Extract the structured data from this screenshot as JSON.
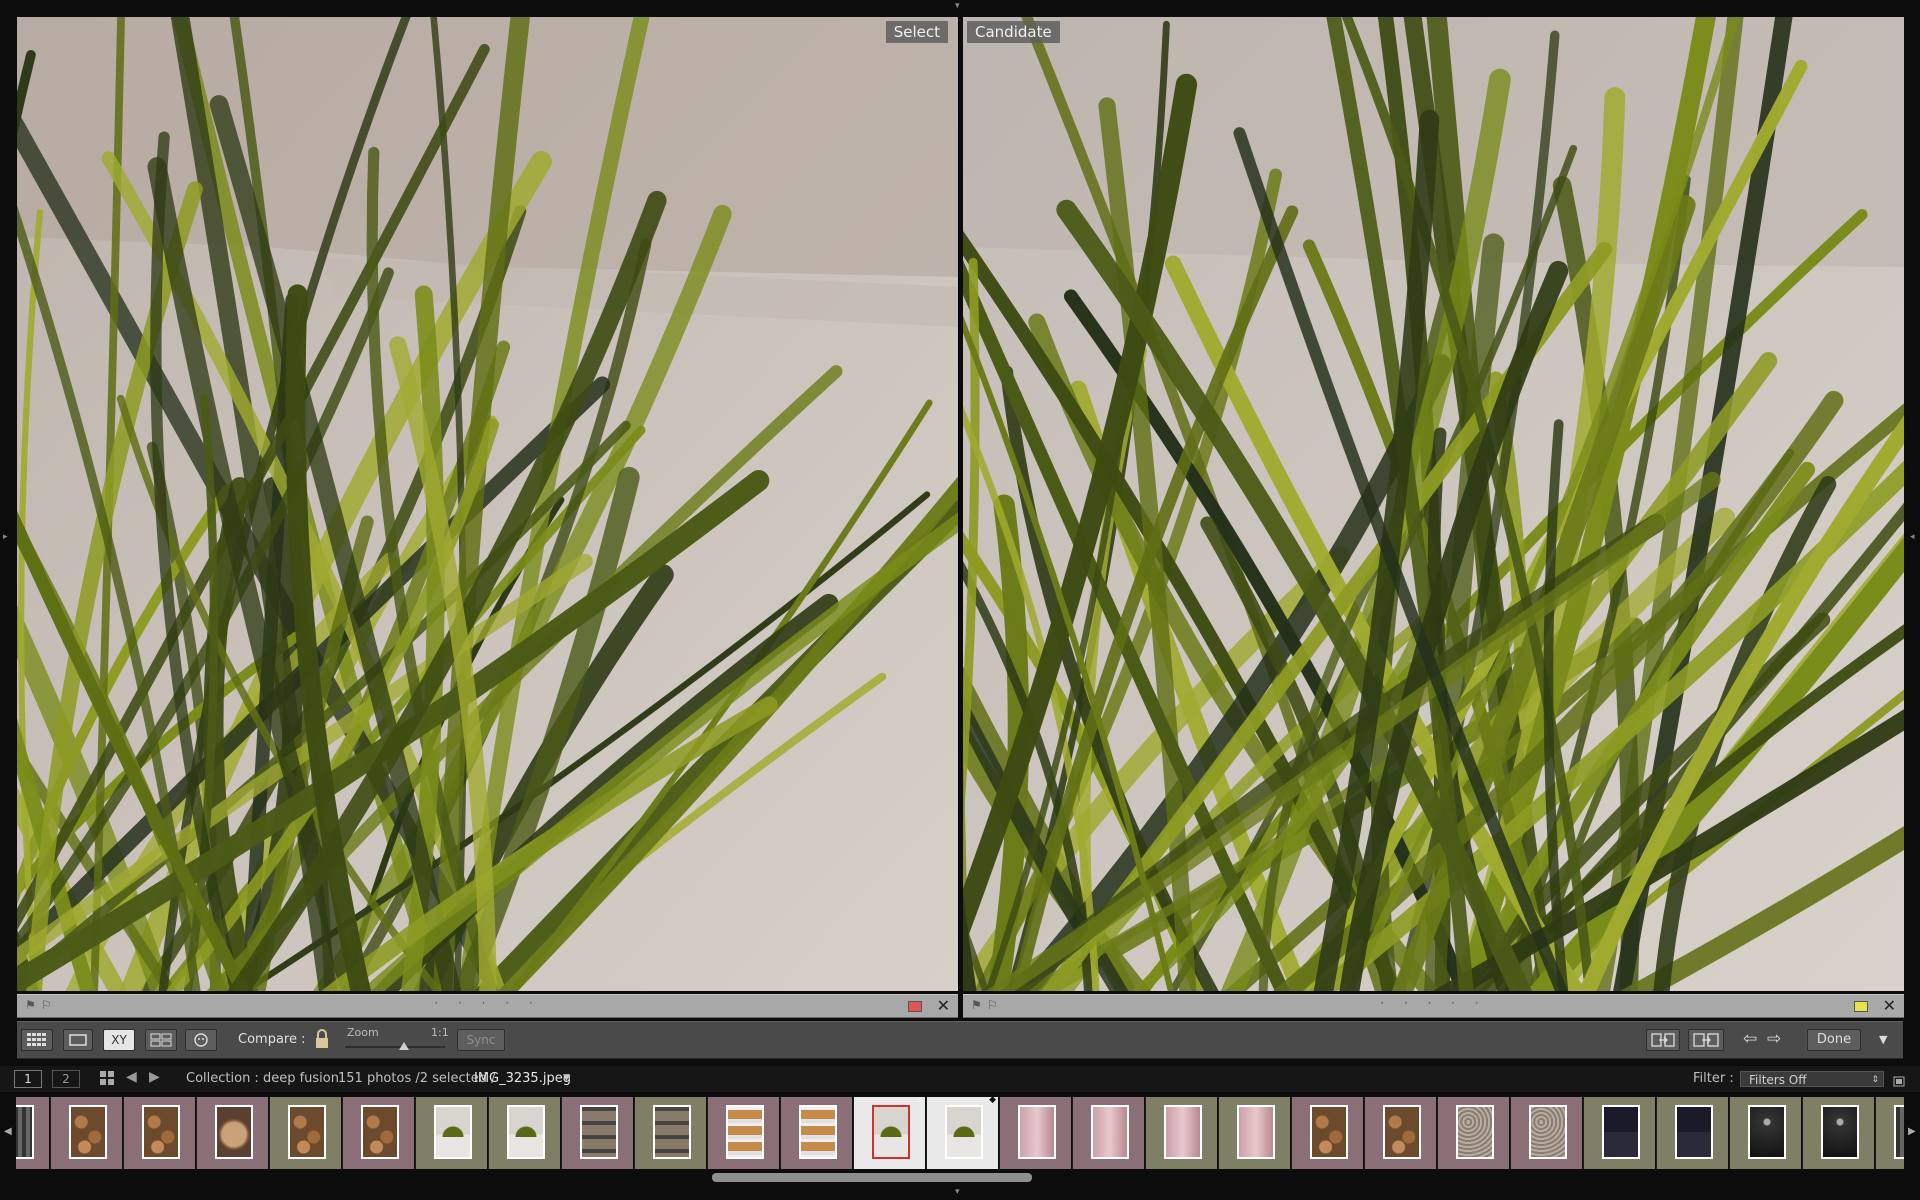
{
  "compare": {
    "select_label": "Select",
    "candidate_label": "Candidate"
  },
  "infostrip": {
    "left_label_color": "#e05555",
    "right_label_color": "#e8e24a",
    "dots": "· · · · ·"
  },
  "toolbar": {
    "compare_label": "Compare :",
    "zoom_label": "Zoom",
    "zoom_value": "1:1",
    "sync_label": "Sync",
    "done_label": "Done",
    "xy_label": "XY"
  },
  "filmstrip_header": {
    "page1": "1",
    "page2": "2",
    "collection": "Collection : deep fusion",
    "count": "151 photos /2 selected /",
    "filename": "IMG_3235.jpeg",
    "filter_label": "Filter :",
    "filter_value": "Filters Off"
  },
  "filmstrip": {
    "thumbs": [
      {
        "kind": "stripes",
        "bg": "#8a6f76"
      },
      {
        "kind": "wood",
        "bg": "#8a6f76"
      },
      {
        "kind": "wood",
        "bg": "#8a6f76"
      },
      {
        "kind": "log",
        "bg": "#8a6f76"
      },
      {
        "kind": "wood",
        "bg": "#7f7f66"
      },
      {
        "kind": "wood",
        "bg": "#8a6f76"
      },
      {
        "kind": "plant",
        "bg": "#7f7f66"
      },
      {
        "kind": "plant",
        "bg": "#7f7f66"
      },
      {
        "kind": "shelf",
        "bg": "#8a6f76"
      },
      {
        "kind": "shelf",
        "bg": "#7f7f66"
      },
      {
        "kind": "shelf2",
        "bg": "#8a6f76"
      },
      {
        "kind": "shelf2",
        "bg": "#8a6f76"
      },
      {
        "kind": "plant",
        "bg": "#e9e9e9",
        "selected": true,
        "active": true
      },
      {
        "kind": "plant",
        "bg": "#e9e9e9",
        "selected": true
      },
      {
        "kind": "pink",
        "bg": "#8a6f76"
      },
      {
        "kind": "pink",
        "bg": "#8a6f76"
      },
      {
        "kind": "pink",
        "bg": "#7f7f66"
      },
      {
        "kind": "pink",
        "bg": "#7f7f66"
      },
      {
        "kind": "wood",
        "bg": "#8a6f76"
      },
      {
        "kind": "wood",
        "bg": "#8a6f76"
      },
      {
        "kind": "texture",
        "bg": "#8a6f76"
      },
      {
        "kind": "texture",
        "bg": "#8a6f76"
      },
      {
        "kind": "screen",
        "bg": "#7f7f66"
      },
      {
        "kind": "screen",
        "bg": "#7f7f66"
      },
      {
        "kind": "dark",
        "bg": "#7f7f66"
      },
      {
        "kind": "dark",
        "bg": "#7f7f66"
      },
      {
        "kind": "stripes",
        "bg": "#7f7f66"
      }
    ]
  }
}
